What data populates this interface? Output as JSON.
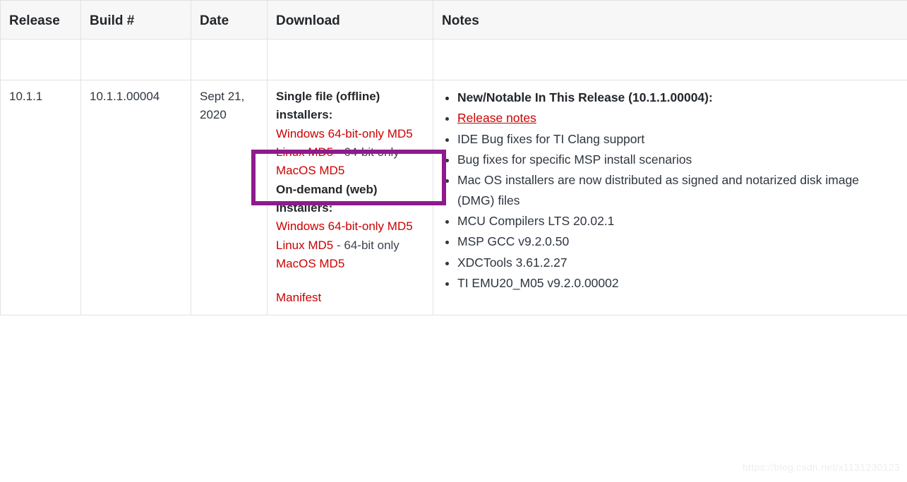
{
  "table": {
    "columns": [
      "Release",
      "Build #",
      "Date",
      "Download",
      "Notes"
    ],
    "row": {
      "release": "10.1.1",
      "build": "10.1.1.00004",
      "date": "Sept 21, 2020",
      "download": {
        "offline_heading": "Single file (offline) installers:",
        "offline_items": [
          {
            "link": "Windows 64-bit-only MD5",
            "suffix": ""
          },
          {
            "link": "Linux MD5",
            "suffix": " - 64-bit only"
          },
          {
            "link": "MacOS MD5",
            "suffix": ""
          }
        ],
        "ondemand_heading": "On-demand (web) installers:",
        "ondemand_items": [
          {
            "link": "Windows 64-bit-only MD5",
            "suffix": ""
          },
          {
            "link": "Linux MD5",
            "suffix": " - 64-bit only"
          },
          {
            "link": "MacOS MD5",
            "suffix": ""
          }
        ],
        "manifest": "Manifest"
      },
      "notes": [
        {
          "text": "New/Notable In This Release (10.1.1.00004):",
          "bold": true,
          "link": false
        },
        {
          "text": "Release notes",
          "bold": false,
          "link": true
        },
        {
          "text": "IDE Bug fixes for TI Clang support",
          "bold": false,
          "link": false
        },
        {
          "text": "Bug fixes for specific MSP install scenarios",
          "bold": false,
          "link": false
        },
        {
          "text": "Mac OS installers are now distributed as signed and notarized disk image (DMG) files",
          "bold": false,
          "link": false
        },
        {
          "text": "MCU Compilers LTS 20.02.1",
          "bold": false,
          "link": false
        },
        {
          "text": "MSP GCC v9.2.0.50",
          "bold": false,
          "link": false
        },
        {
          "text": "XDCTools 3.61.2.27",
          "bold": false,
          "link": false
        },
        {
          "text": "TI EMU20_M05 v9.2.0.00002",
          "bold": false,
          "link": false
        }
      ]
    }
  },
  "annotation": {
    "color": "#8e1a8e",
    "target": "Windows 64-bit-only MD5"
  },
  "watermark": "https://blog.csdn.net/x1131230123",
  "colors": {
    "link_red": "#cc0000",
    "text": "#2f3640",
    "header_bg": "#f7f7f7",
    "border": "#e2e2e2",
    "annotation_purple": "#8e1a8e"
  }
}
